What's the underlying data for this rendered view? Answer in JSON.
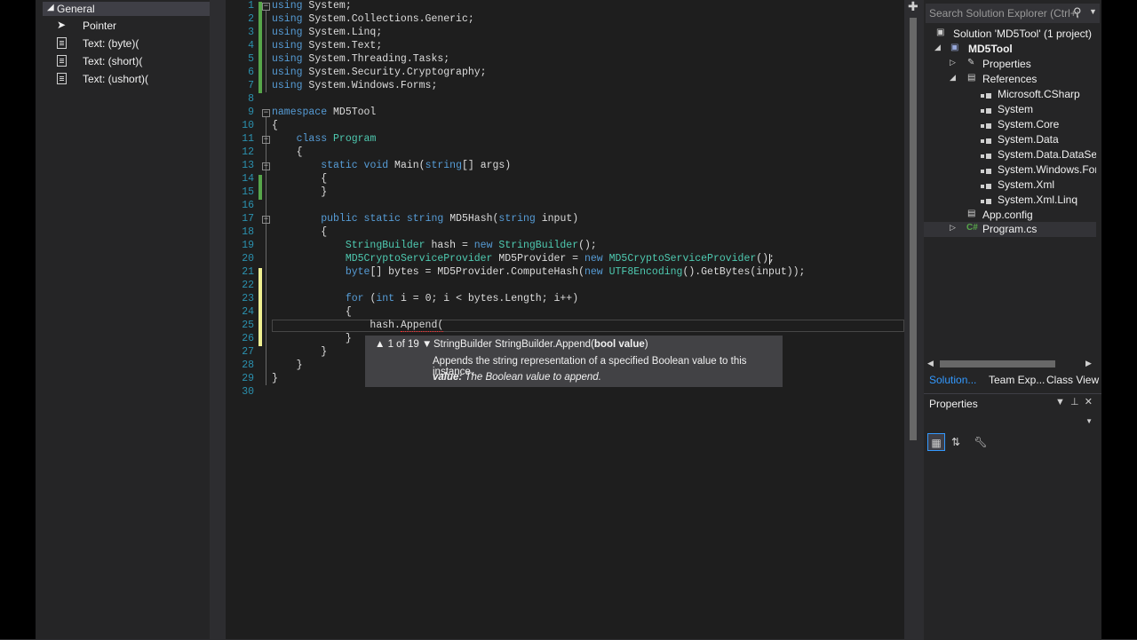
{
  "toolbox": {
    "group": "General",
    "items": [
      {
        "label": "Pointer",
        "icon": "pointer-icon"
      },
      {
        "label": "Text: (byte)(",
        "icon": "text-snippet-icon"
      },
      {
        "label": "Text: (short)(",
        "icon": "text-snippet-icon"
      },
      {
        "label": "Text: (ushort)(",
        "icon": "text-snippet-icon"
      }
    ]
  },
  "editor": {
    "line_numbers": [
      "1",
      "2",
      "3",
      "4",
      "5",
      "6",
      "7",
      "8",
      "9",
      "10",
      "11",
      "12",
      "13",
      "14",
      "15",
      "16",
      "17",
      "18",
      "19",
      "20",
      "21",
      "22",
      "23",
      "24",
      "25",
      "26",
      "27",
      "28",
      "29",
      "30"
    ],
    "code": {
      "l1_kw": "using",
      "l1": " System;",
      "l2_kw": "using",
      "l2": " System.Collections.Generic;",
      "l3_kw": "using",
      "l3": " System.Linq;",
      "l4_kw": "using",
      "l4": " System.Text;",
      "l5_kw": "using",
      "l5": " System.Threading.Tasks;",
      "l6_kw": "using",
      "l6": " System.Security.Cryptography;",
      "l7_kw": "using",
      "l7": " System.Windows.Forms;",
      "l9_kw": "namespace",
      "l9": " MD5Tool",
      "l10": "{",
      "l11_kw": "class",
      "l11_ty": "Program",
      "l12": "{",
      "l13_kw1": "static",
      "l13_kw2": "void",
      "l13_a": " Main(",
      "l13_kw3": "string",
      "l13_b": "[] args)",
      "l14": "{",
      "l15": "}",
      "l17_kw1": "public",
      "l17_kw2": "static",
      "l17_kw3": "string",
      "l17_a": " MD5Hash(",
      "l17_kw4": "string",
      "l17_b": " input)",
      "l18": "{",
      "l19_ty1": "StringBuilder",
      "l19_a": " hash = ",
      "l19_kw": "new",
      "l19_ty2": "StringBuilder",
      "l19_b": "();",
      "l20_ty1": "MD5CryptoServiceProvider",
      "l20_a": " MD5Provider = ",
      "l20_kw": "new",
      "l20_ty2": "MD5CryptoServiceProvider",
      "l20_b": "();",
      "l21_kw1": "byte",
      "l21_a": "[] bytes = MD5Provider.ComputeHash(",
      "l21_kw2": "new",
      "l21_ty": "UTF8Encoding",
      "l21_b": "().GetBytes(input));",
      "l23_kw1": "for",
      "l23_a": " (",
      "l23_kw2": "int",
      "l23_b": " i = 0; i < bytes.Length; i++)",
      "l24": "{",
      "l25_a": "hash.",
      "l25_b": "Append(",
      "l26": "}",
      "l27": "}",
      "l28": "}",
      "l29": "}"
    },
    "tooltip": {
      "nav": "▲ 1 of 19 ▼",
      "signature": "StringBuilder StringBuilder.Append(",
      "param_bold": "bool value",
      "signature_end": ")",
      "description": "Appends the string representation of a specified Boolean value to this instance.",
      "param_name": "value:",
      "param_desc": " The Boolean value to append."
    }
  },
  "solution_explorer": {
    "search_placeholder": "Search Solution Explorer (Ctrl+;",
    "solution": "Solution 'MD5Tool' (1 project)",
    "project": "MD5Tool",
    "properties": "Properties",
    "references": "References",
    "refs": [
      "Microsoft.CSharp",
      "System",
      "System.Core",
      "System.Data",
      "System.Data.DataSetEx",
      "System.Windows.Form",
      "System.Xml",
      "System.Xml.Linq"
    ],
    "app_config": "App.config",
    "program_cs": "Program.cs",
    "tabs": [
      "Solution...",
      "Team Exp...",
      "Class View"
    ]
  },
  "properties_panel": {
    "title": "Properties"
  },
  "colors": {
    "keyword": "#569cd6",
    "type": "#4ec9b0",
    "line_number": "#2b91af",
    "accent": "#3399ff"
  }
}
